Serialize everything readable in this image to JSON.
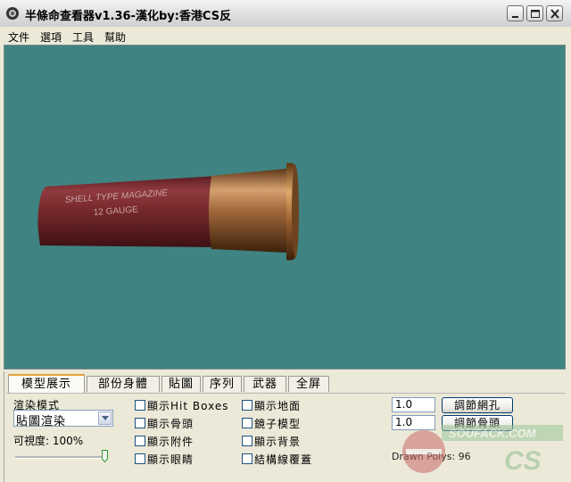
{
  "window": {
    "title": "半條命查看器v1.36-漢化by:香港CS反"
  },
  "menu": [
    "文件",
    "選項",
    "工具",
    "幫助"
  ],
  "model": {
    "line1": "SHELL TYPE MAGAZINE",
    "line2": "12 GAUGE"
  },
  "tabs": [
    "模型展示",
    "部份身體",
    "貼圖",
    "序列",
    "武器",
    "全屏"
  ],
  "render": {
    "mode_label": "渲染模式",
    "mode_value": "貼圖渲染",
    "visibility_label": "可視度: 100%",
    "visibility": 1.0
  },
  "checkboxes": {
    "col1": [
      "顯示Hit Boxes",
      "顯示骨頭",
      "顯示附件",
      "顯示眼睛"
    ],
    "col2": [
      "顯示地面",
      "鏡子模型",
      "顯示背景",
      "結構線覆蓋"
    ]
  },
  "adjust": {
    "mesh_value": "1.0",
    "mesh_button": "調節網孔",
    "bone_value": "1.0",
    "bone_button": "調節骨頭",
    "drawn_polys": "Drawn Polys: 96"
  },
  "colors": {
    "viewport_bg": "#3f8382",
    "shell_body": "#7a2a2e",
    "shell_brass": "#a0683a"
  },
  "watermark": {
    "site": "SOUFACK.COM",
    "brand": "CS"
  }
}
